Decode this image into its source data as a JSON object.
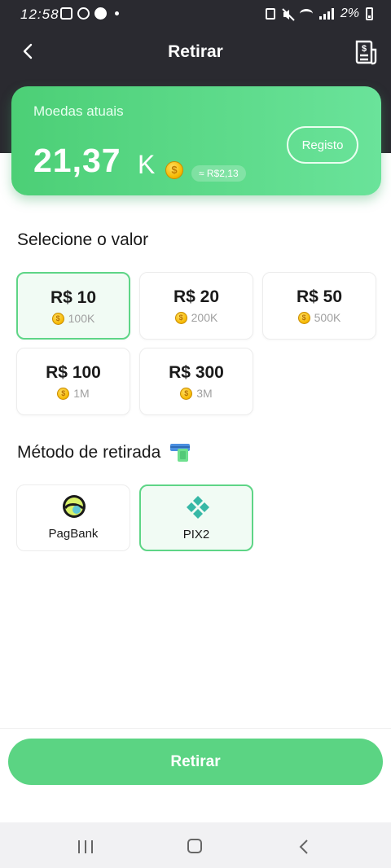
{
  "status_bar": {
    "time": "12:58",
    "battery": "2%"
  },
  "nav": {
    "title": "Retirar"
  },
  "coins_card": {
    "label": "Moedas atuais",
    "value": "21,37",
    "unit": "K",
    "brl_equivalent": "≈ R$2,13",
    "history_button": "Registo"
  },
  "values_section": {
    "title": "Selecione o valor",
    "options": [
      {
        "amount": "R$ 10",
        "coins": "100K",
        "selected": true
      },
      {
        "amount": "R$ 20",
        "coins": "200K",
        "selected": false
      },
      {
        "amount": "R$ 50",
        "coins": "500K",
        "selected": false
      },
      {
        "amount": "R$ 100",
        "coins": "1M",
        "selected": false
      },
      {
        "amount": "R$ 300",
        "coins": "3M",
        "selected": false
      }
    ]
  },
  "method_section": {
    "title": "Método de retirada",
    "methods": [
      {
        "name": "PagBank",
        "selected": false
      },
      {
        "name": "PIX2",
        "selected": true
      }
    ]
  },
  "withdraw_button": "Retirar",
  "colors": {
    "header_bg": "#2a2a30",
    "accent_green": "#5bd483",
    "selected_bg": "#f1fbf4"
  }
}
